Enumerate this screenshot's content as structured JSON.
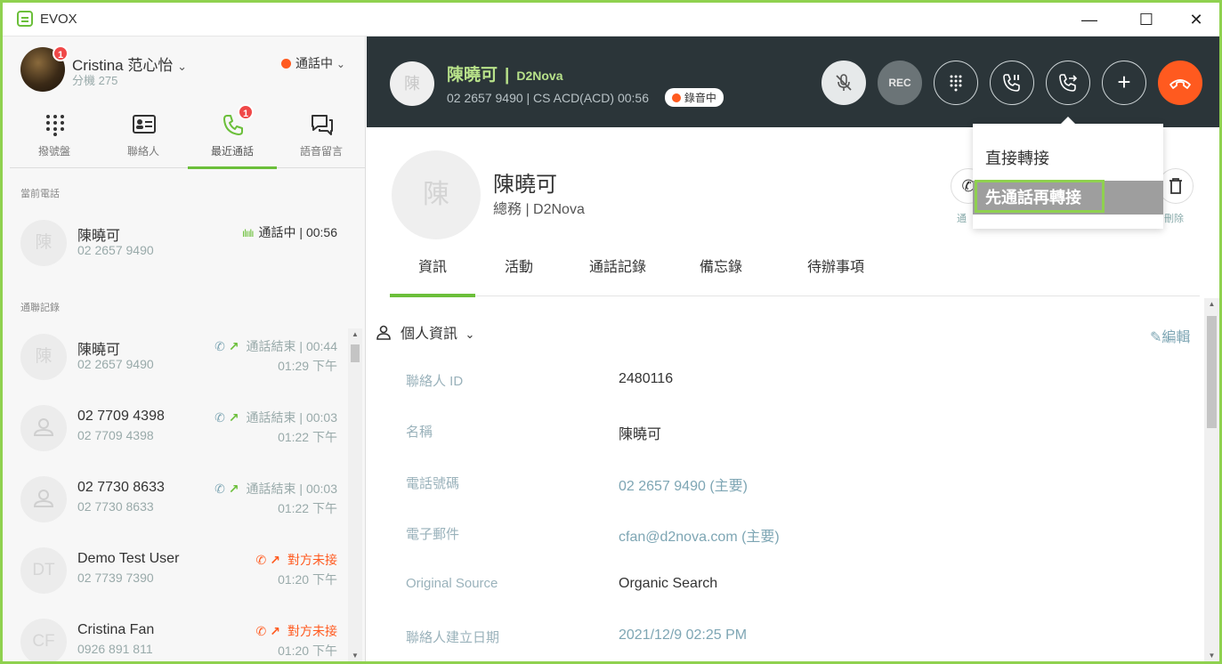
{
  "window": {
    "app_name": "EVOX",
    "minimize": "—",
    "maximize": "☐",
    "close": "✕"
  },
  "user": {
    "name": "Cristina 范心怡",
    "name_caret": "⌄",
    "extension": "分機 275",
    "badge": "1",
    "status": "通話中",
    "status_caret": "⌄"
  },
  "nav": {
    "tabs": [
      {
        "label": "撥號盤"
      },
      {
        "label": "聯絡人"
      },
      {
        "label": "最近通話",
        "badge": "1"
      },
      {
        "label": "語音留言"
      }
    ]
  },
  "current_call_section": {
    "title": "當前電話",
    "item": {
      "avatar": "陳",
      "name": "陳曉可",
      "phone": "02 2657 9490",
      "wave": "ılıılı",
      "status": "通話中 | 00:56"
    }
  },
  "history_section": {
    "title": "通聯記錄",
    "items": [
      {
        "avatar": "陳",
        "name": "陳曉可",
        "phone": "02 2657 9490",
        "status": "通話結束 | 00:44",
        "time": "01:29 下午",
        "icon": "✆",
        "arrow": "↗"
      },
      {
        "avatar": "",
        "name": "02 7709 4398",
        "phone": "02 7709 4398",
        "status": "通話結束 | 00:03",
        "time": "01:22 下午",
        "icon": "✆",
        "arrow": "↗"
      },
      {
        "avatar": "",
        "name": "02 7730 8633",
        "phone": "02 7730 8633",
        "status": "通話結束 | 00:03",
        "time": "01:22 下午",
        "icon": "✆",
        "arrow": "↗"
      },
      {
        "avatar": "DT",
        "name": "Demo Test User",
        "phone": "02 7739 7390",
        "status": "對方未接",
        "time": "01:20 下午",
        "icon": "✆",
        "arrow": "↗"
      },
      {
        "avatar": "CF",
        "name": "Cristina Fan",
        "phone": "0926 891 811",
        "status": "對方未接",
        "time": "01:20 下午",
        "icon": "✆",
        "arrow": "↗"
      }
    ]
  },
  "call_bar": {
    "avatar": "陳",
    "name": "陳曉可",
    "separator": "|",
    "company": "D2Nova",
    "details": "02 2657 9490 | CS ACD(ACD)  00:56",
    "recording_label": "錄音中",
    "rec_button": "REC",
    "add_symbol": "+"
  },
  "contact": {
    "avatar": "陳",
    "name": "陳曉可",
    "subtitle": "總務 | D2Nova",
    "action_call_label": "通",
    "action_delete_label": "刪除"
  },
  "detail_tabs": [
    "資訊",
    "活動",
    "通話記錄",
    "備忘錄",
    "待辦事項"
  ],
  "info_section": {
    "title": "個人資訊",
    "title_caret": "⌄",
    "edit_label": "編輯",
    "edit_icon": "✎",
    "fields": [
      {
        "label": "聯絡人 ID",
        "value": "2480116",
        "is_link": false
      },
      {
        "label": "名稱",
        "value": "陳曉可",
        "is_link": false
      },
      {
        "label": "電話號碼",
        "value": "02 2657 9490 (主要)",
        "is_link": true
      },
      {
        "label": "電子郵件",
        "value": "cfan@d2nova.com (主要)",
        "is_link": true
      },
      {
        "label": "Original Source",
        "value": "Organic Search",
        "is_link": false
      },
      {
        "label": "聯絡人建立日期",
        "value": "2021/12/9 02:25 PM",
        "is_link": true
      }
    ]
  },
  "transfer_menu": {
    "items": [
      {
        "label": "直接轉接"
      },
      {
        "label": "先通話再轉接"
      }
    ]
  },
  "colors": {
    "accent_green": "#6bbf3a",
    "call_bar_bg": "#2b3539",
    "hangup_orange": "#ff5a1f",
    "link_blue_gray": "#7ea6b4",
    "missed_orange": "#ff5a1f"
  }
}
